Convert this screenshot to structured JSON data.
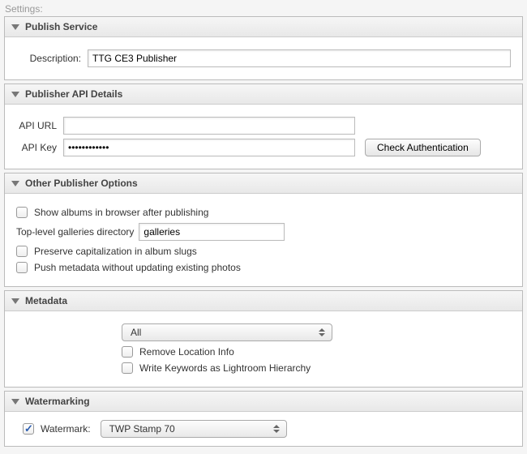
{
  "header": {
    "settings_label": "Settings:"
  },
  "publish_service": {
    "title": "Publish Service",
    "description_label": "Description:",
    "description_value": "TTG CE3 Publisher"
  },
  "api_details": {
    "title": "Publisher API Details",
    "api_url_label": "API URL",
    "api_url_value": "",
    "api_key_label": "API Key",
    "api_key_value": "••••••••••••",
    "check_auth_label": "Check Authentication"
  },
  "other_options": {
    "title": "Other Publisher Options",
    "show_albums_label": "Show albums in browser after publishing",
    "show_albums_checked": false,
    "top_galleries_label": "Top-level galleries directory",
    "top_galleries_value": "galleries",
    "preserve_caps_label": "Preserve capitalization in album slugs",
    "preserve_caps_checked": false,
    "push_metadata_label": "Push metadata without updating existing photos",
    "push_metadata_checked": false
  },
  "metadata": {
    "title": "Metadata",
    "select_value": "All",
    "remove_location_label": "Remove Location Info",
    "remove_location_checked": false,
    "write_keywords_label": "Write Keywords as Lightroom Hierarchy",
    "write_keywords_checked": false
  },
  "watermarking": {
    "title": "Watermarking",
    "watermark_label": "Watermark:",
    "watermark_checked": true,
    "watermark_select_value": "TWP Stamp 70"
  }
}
